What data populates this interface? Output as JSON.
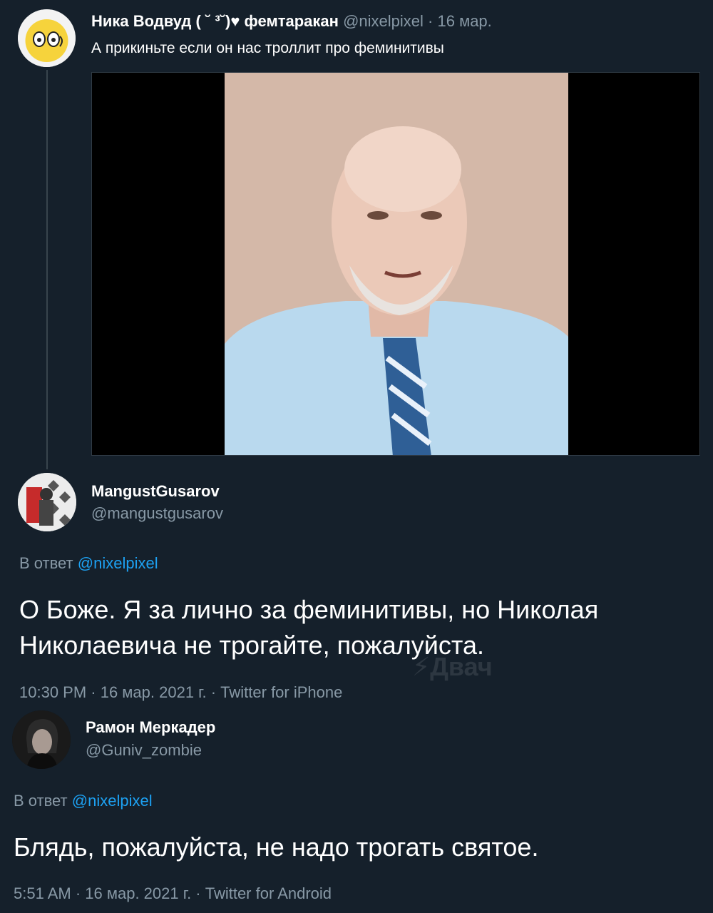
{
  "tweets": [
    {
      "name": "Ника Водвуд ( ˘ ³˘)♥ фемтаракан",
      "handle": "@nixelpixel",
      "date": "16 мар.",
      "text": "А прикиньте если он нас троллит про феминитивы"
    },
    {
      "name": "MangustGusarov",
      "handle": "@mangustgusarov",
      "reply_prefix": "В ответ",
      "reply_mention": "@nixelpixel",
      "text_line1": "О Боже. Я за лично за феминитивы, но Николая",
      "text_line2": "Николаевича не трогайте, пожалуйста.",
      "meta": "10:30 PM · 16 мар. 2021 г. · Twitter for iPhone"
    },
    {
      "name": "Рамон Меркадер",
      "handle": "@Guniv_zombie",
      "reply_prefix": "В ответ",
      "reply_mention": "@nixelpixel",
      "text": "Блядь, пожалуйста, не надо трогать святое.",
      "meta": "5:51 AM · 16 мар. 2021 г. · Twitter for Android"
    }
  ],
  "watermark": "Двач",
  "icons": {
    "watermark_logo": "lightning-bolt-icon"
  },
  "colors": {
    "background": "#15202b",
    "muted": "#8899a6",
    "link": "#1da1f2",
    "thread_line": "#38444d"
  }
}
